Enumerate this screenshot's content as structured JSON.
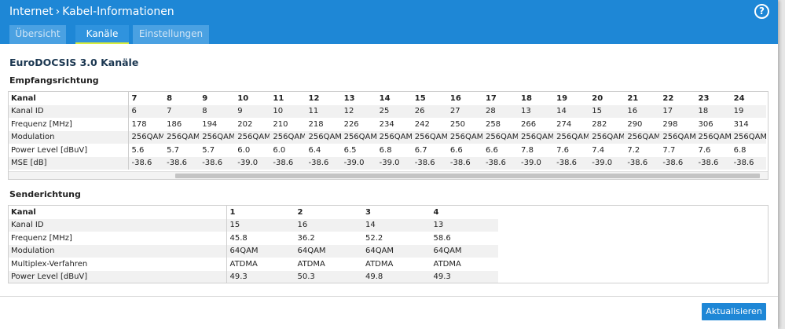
{
  "header": {
    "crumb_root": "Internet",
    "crumb_sep": "›",
    "crumb_page": "Kabel-Informationen",
    "help_label": "?"
  },
  "tabs": [
    {
      "label": "Übersicht",
      "active": false
    },
    {
      "label": "Kanäle",
      "active": true
    },
    {
      "label": "Einstellungen",
      "active": false
    }
  ],
  "section_title": "EuroDOCSIS 3.0 Kanäle",
  "downstream": {
    "title": "Empfangsrichtung",
    "rows": [
      {
        "label": "Kanal",
        "values": [
          "7",
          "8",
          "9",
          "10",
          "11",
          "12",
          "13",
          "14",
          "15",
          "16",
          "17",
          "18",
          "19",
          "20",
          "21",
          "22",
          "23",
          "24"
        ]
      },
      {
        "label": "Kanal ID",
        "values": [
          "6",
          "7",
          "8",
          "9",
          "10",
          "11",
          "12",
          "25",
          "26",
          "27",
          "28",
          "13",
          "14",
          "15",
          "16",
          "17",
          "18",
          "19"
        ]
      },
      {
        "label": "Frequenz [MHz]",
        "values": [
          "178",
          "186",
          "194",
          "202",
          "210",
          "218",
          "226",
          "234",
          "242",
          "250",
          "258",
          "266",
          "274",
          "282",
          "290",
          "298",
          "306",
          "314"
        ]
      },
      {
        "label": "Modulation",
        "values": [
          "256QAM",
          "256QAM",
          "256QAM",
          "256QAM",
          "256QAM",
          "256QAM",
          "256QAM",
          "256QAM",
          "256QAM",
          "256QAM",
          "256QAM",
          "256QAM",
          "256QAM",
          "256QAM",
          "256QAM",
          "256QAM",
          "256QAM",
          "256QAM"
        ]
      },
      {
        "label": "Power Level [dBuV]",
        "values": [
          "5.6",
          "5.7",
          "5.7",
          "6.0",
          "6.0",
          "6.4",
          "6.5",
          "6.8",
          "6.7",
          "6.6",
          "6.6",
          "7.8",
          "7.6",
          "7.4",
          "7.2",
          "7.7",
          "7.6",
          "6.8"
        ]
      },
      {
        "label": "MSE [dB]",
        "values": [
          "-38.6",
          "-38.6",
          "-38.6",
          "-39.0",
          "-38.6",
          "-38.6",
          "-39.0",
          "-39.0",
          "-38.6",
          "-38.6",
          "-38.6",
          "-39.0",
          "-38.6",
          "-39.0",
          "-38.6",
          "-38.6",
          "-38.6",
          "-38.6"
        ]
      }
    ]
  },
  "upstream": {
    "title": "Senderichtung",
    "rows": [
      {
        "label": "Kanal",
        "values": [
          "1",
          "2",
          "3",
          "4"
        ]
      },
      {
        "label": "Kanal ID",
        "values": [
          "15",
          "16",
          "14",
          "13"
        ]
      },
      {
        "label": "Frequenz [MHz]",
        "values": [
          "45.8",
          "36.2",
          "52.2",
          "58.6"
        ]
      },
      {
        "label": "Modulation",
        "values": [
          "64QAM",
          "64QAM",
          "64QAM",
          "64QAM"
        ]
      },
      {
        "label": "Multiplex-Verfahren",
        "values": [
          "ATDMA",
          "ATDMA",
          "ATDMA",
          "ATDMA"
        ]
      },
      {
        "label": "Power Level [dBuV]",
        "values": [
          "49.3",
          "50.3",
          "49.8",
          "49.3"
        ]
      }
    ]
  },
  "button_refresh": "Aktualisieren"
}
